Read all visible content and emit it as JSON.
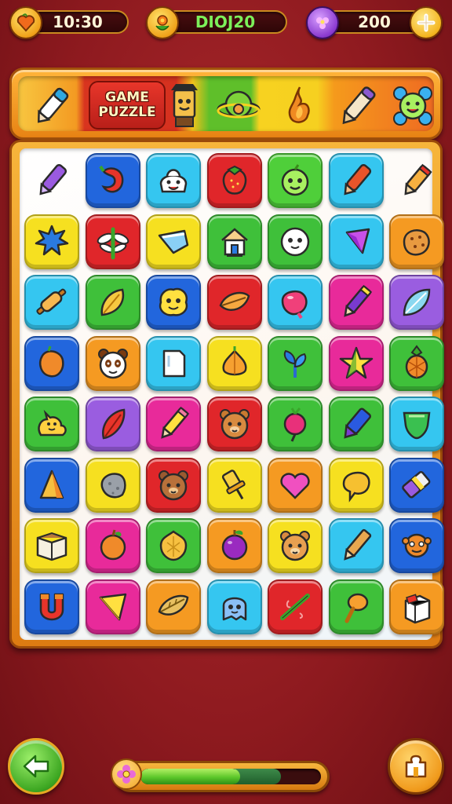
{
  "hud": {
    "time": "10:30",
    "level_code": "DIOJ20",
    "gems": "200"
  },
  "banner": {
    "title_line1": "GAME",
    "title_line2": "PUZZLE"
  },
  "board": {
    "columns": 7,
    "rows": 8,
    "tiles": [
      {
        "bg": "none",
        "icon": "purple-marker-icon"
      },
      {
        "bg": "#2266dd",
        "icon": "red-chili-icon"
      },
      {
        "bg": "#35c6f0",
        "icon": "smiling-cream-icon"
      },
      {
        "bg": "#e0262a",
        "icon": "strawberry-icon"
      },
      {
        "bg": "#4fcf3a",
        "icon": "green-face-icon"
      },
      {
        "bg": "#35c6f0",
        "icon": "red-pen-icon"
      },
      {
        "bg": "none",
        "icon": "orange-crayon-icon"
      },
      {
        "bg": "#f6e020",
        "icon": "blue-splat-icon"
      },
      {
        "bg": "#e0262a",
        "icon": "dragonfly-icon"
      },
      {
        "bg": "#f6e020",
        "icon": "blue-paper-icon"
      },
      {
        "bg": "#3fc03a",
        "icon": "house-icon"
      },
      {
        "bg": "#3fc03a",
        "icon": "white-blob-face-icon"
      },
      {
        "bg": "#35c6f0",
        "icon": "purple-gem-icon"
      },
      {
        "bg": "#f59a22",
        "icon": "cookie-icon"
      },
      {
        "bg": "#35c6f0",
        "icon": "rolling-pin-icon"
      },
      {
        "bg": "#3fc03a",
        "icon": "yellow-leaf-icon"
      },
      {
        "bg": "#2266dd",
        "icon": "yellow-blob-face-icon"
      },
      {
        "bg": "#e0262a",
        "icon": "orange-leaf-icon"
      },
      {
        "bg": "#35c6f0",
        "icon": "pink-candy-icon"
      },
      {
        "bg": "#e82a9a",
        "icon": "purple-pencil-icon"
      },
      {
        "bg": "#9a5de0",
        "icon": "blue-feather-icon"
      },
      {
        "bg": "#2266dd",
        "icon": "orange-bean-icon"
      },
      {
        "bg": "#f59a22",
        "icon": "panda-face-icon"
      },
      {
        "bg": "#35c6f0",
        "icon": "white-note-icon"
      },
      {
        "bg": "#f6e020",
        "icon": "onion-icon"
      },
      {
        "bg": "#3fc03a",
        "icon": "blue-sprout-icon"
      },
      {
        "bg": "#e82a9a",
        "icon": "star-icon"
      },
      {
        "bg": "#3fc03a",
        "icon": "pineapple-icon"
      },
      {
        "bg": "#3fc03a",
        "icon": "yellow-cat-icon"
      },
      {
        "bg": "#9a5de0",
        "icon": "red-feather-icon"
      },
      {
        "bg": "#e82a9a",
        "icon": "yellow-pencil-icon"
      },
      {
        "bg": "#e0262a",
        "icon": "bear-face-icon"
      },
      {
        "bg": "#3fc03a",
        "icon": "radish-icon"
      },
      {
        "bg": "#3fc03a",
        "icon": "blue-marker-icon"
      },
      {
        "bg": "#35c6f0",
        "icon": "green-shield-icon"
      },
      {
        "bg": "#2266dd",
        "icon": "orange-cone-icon"
      },
      {
        "bg": "#f6e020",
        "icon": "grey-stone-icon"
      },
      {
        "bg": "#e0262a",
        "icon": "brown-bear-icon"
      },
      {
        "bg": "#f6e020",
        "icon": "pushpin-icon"
      },
      {
        "bg": "#f59a22",
        "icon": "pink-heart-icon"
      },
      {
        "bg": "#f6e020",
        "icon": "speech-bubble-icon"
      },
      {
        "bg": "#2266dd",
        "icon": "eraser-icon"
      },
      {
        "bg": "#f6e020",
        "icon": "book-icon"
      },
      {
        "bg": "#e82a9a",
        "icon": "orange-fruit-icon"
      },
      {
        "bg": "#3fc03a",
        "icon": "yellow-flower-icon"
      },
      {
        "bg": "#f59a22",
        "icon": "plum-icon"
      },
      {
        "bg": "#f6e020",
        "icon": "teddy-face-icon"
      },
      {
        "bg": "#35c6f0",
        "icon": "brown-pencil-icon"
      },
      {
        "bg": "#2266dd",
        "icon": "orange-monster-icon"
      },
      {
        "bg": "#2266dd",
        "icon": "red-magnet-icon"
      },
      {
        "bg": "#e82a9a",
        "icon": "yellow-kite-icon"
      },
      {
        "bg": "#f59a22",
        "icon": "leaf-icon"
      },
      {
        "bg": "#35c6f0",
        "icon": "blue-ghost-icon"
      },
      {
        "bg": "#e0262a",
        "icon": "green-stick-icon"
      },
      {
        "bg": "#3fc03a",
        "icon": "orange-spoon-icon"
      },
      {
        "bg": "#f59a22",
        "icon": "white-box-icon"
      }
    ]
  },
  "progress": {
    "level": 0.55,
    "secondary_level": 0.78
  },
  "colors": {
    "background": "#9c2025",
    "frame": "#f0a22a",
    "hud_pill": "#3a0a0c"
  }
}
